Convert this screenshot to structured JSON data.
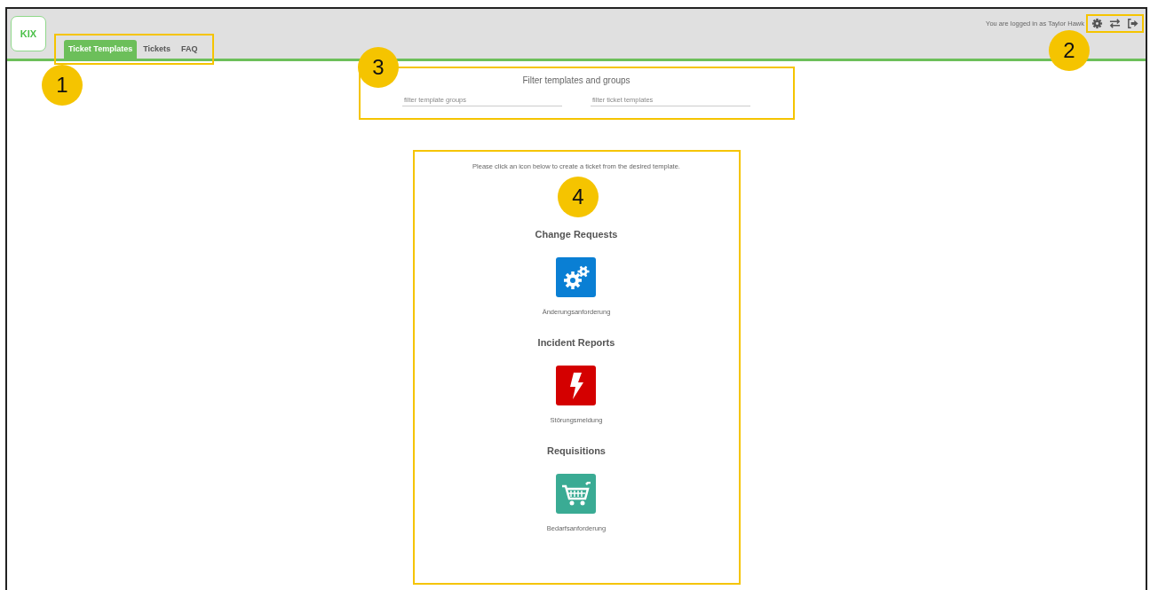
{
  "header": {
    "logo": "KIX",
    "tabs": [
      {
        "label": "Ticket Templates",
        "selected": true
      },
      {
        "label": "Tickets",
        "selected": false
      },
      {
        "label": "FAQ",
        "selected": false
      }
    ],
    "user_text": "You are logged in as Taylor Hawk",
    "actions": [
      {
        "kind": "settings"
      },
      {
        "kind": "switch"
      },
      {
        "kind": "logout"
      }
    ]
  },
  "filter": {
    "title": "Filter templates and groups",
    "fields": [
      {
        "placeholder": "filter template groups"
      },
      {
        "placeholder": "filter ticket templates"
      }
    ]
  },
  "templates": {
    "instruction": "Please click an icon below to create a ticket from the desired template.",
    "groups": [
      {
        "title": "Change Requests",
        "items": [
          {
            "label": "Änderungsanforderung",
            "kind": "gears",
            "color": "#0a7fd4"
          }
        ]
      },
      {
        "title": "Incident Reports",
        "items": [
          {
            "label": "Störungsmeldung",
            "kind": "bolt",
            "color": "#d40000"
          }
        ]
      },
      {
        "title": "Requisitions",
        "items": [
          {
            "label": "Bedarfsanforderung",
            "kind": "cart",
            "color": "#3aab94"
          }
        ]
      }
    ]
  },
  "annotations": [
    {
      "number": "1"
    },
    {
      "number": "2"
    },
    {
      "number": "3"
    },
    {
      "number": "4"
    }
  ]
}
